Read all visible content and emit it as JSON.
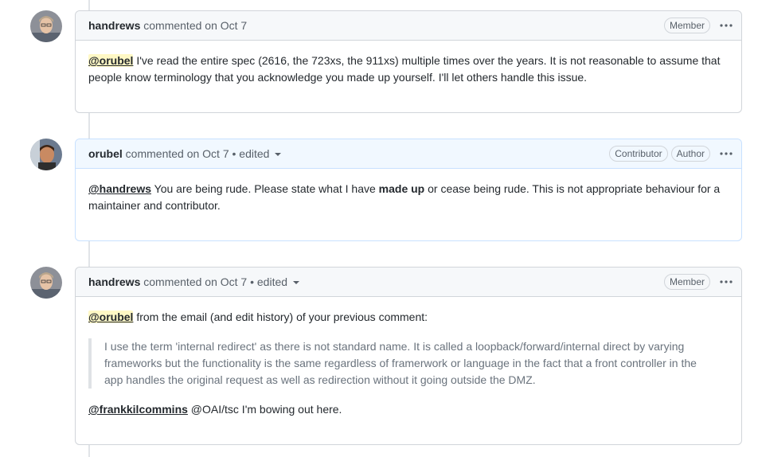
{
  "comments": [
    {
      "user": "handrews",
      "action": "commented on Oct 7",
      "badges": [
        "Member"
      ],
      "mention": "@orubel",
      "text": " I've read the entire spec (2616, the 723xs, the 911xs) multiple times over the years. It is not reasonable to assume that people know terminology that you acknowledge you made up yourself. I'll let others handle this issue."
    },
    {
      "user": "orubel",
      "action": "commented on Oct 7",
      "edited": " • edited",
      "badges": [
        "Contributor",
        "Author"
      ],
      "mention": "@handrews",
      "text_pre": " You are being rude. Please state what I have ",
      "bold": "made up",
      "text_post": " or cease being rude. This is not appropriate behaviour for a maintainer and contributor."
    },
    {
      "user": "handrews",
      "action": "commented on Oct 7",
      "edited": " • edited",
      "badges": [
        "Member"
      ],
      "mention": "@orubel",
      "text": " from the email (and edit history) of your previous comment:",
      "quote": "I use the term 'internal redirect' as there is not standard name. It is called a loopback/forward/internal direct by varying frameworks but the functionality is the same regardless of framerwork or language in the fact that a front controller in the app handles the original request as well as redirection without it going outside the DMZ.",
      "mention2": "@frankkilcommins",
      "text2": " @OAI/tsc I'm bowing out here."
    }
  ],
  "icons": {
    "more": "kebab-horizontal-icon",
    "caret": "triangle-down-icon"
  },
  "colors": {
    "author_header": "#f1f8ff",
    "author_border": "#c8e1ff",
    "mention_highlight": "#fff8c5"
  }
}
